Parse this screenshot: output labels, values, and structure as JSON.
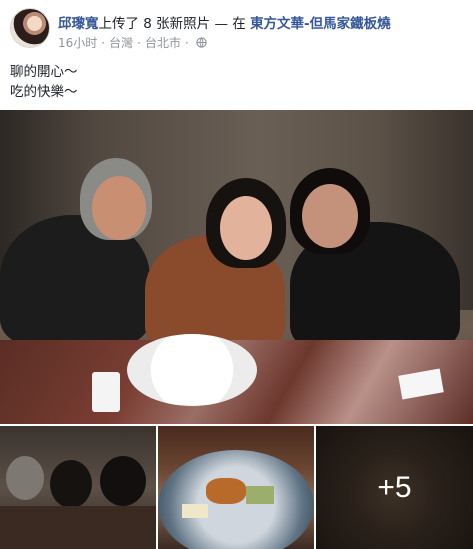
{
  "post": {
    "author": "邱瓈寬",
    "action": "上传了 8 张新照片 — 在",
    "place": "東方文華-但馬家鐵板燒",
    "time": "16小时",
    "location1": "台灣",
    "location2": "台北市",
    "privacy_icon": "globe-icon",
    "text_lines": [
      "聊的開心～",
      "吃的快樂～"
    ]
  },
  "photos": {
    "more_count": "+5"
  },
  "colors": {
    "link": "#365899",
    "meta": "#90949c"
  }
}
